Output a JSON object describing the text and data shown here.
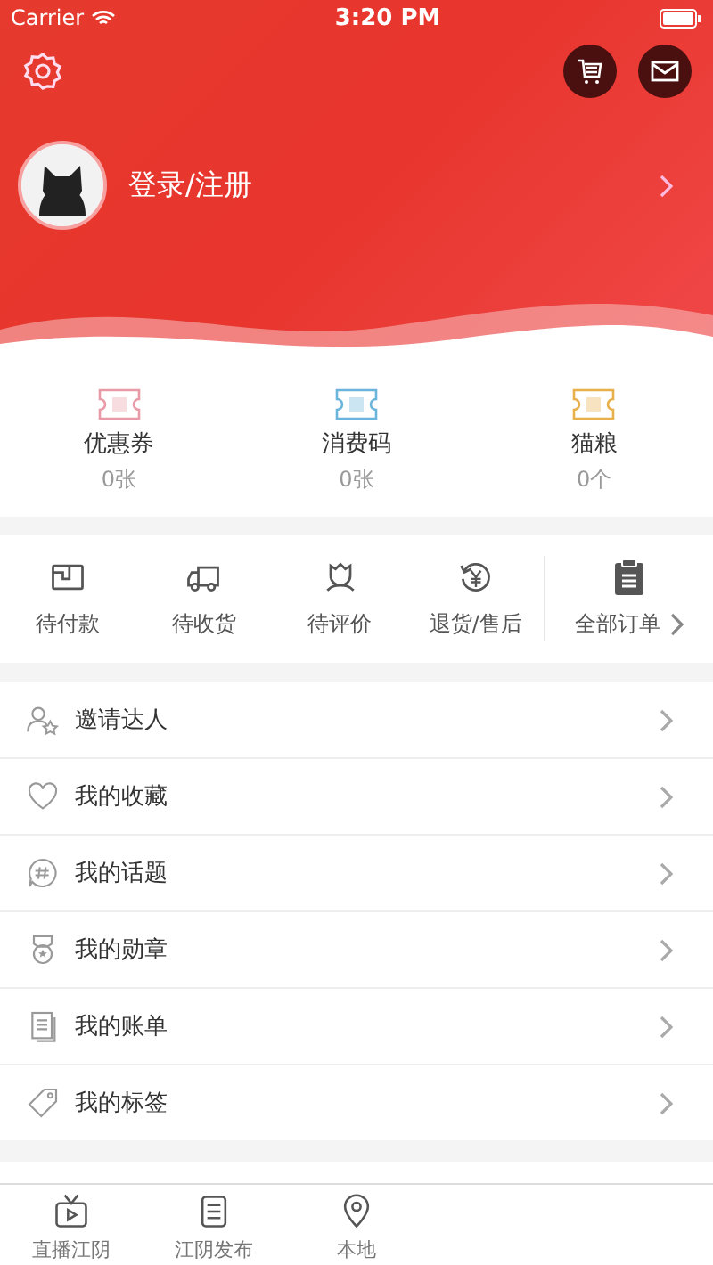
{
  "status_bar": {
    "carrier": "Carrier",
    "time": "3:20 PM"
  },
  "profile": {
    "login_label": "登录/注册"
  },
  "wallet": [
    {
      "kind": "coupon",
      "label": "优惠券",
      "count": "0张"
    },
    {
      "kind": "code",
      "label": "消费码",
      "count": "0张"
    },
    {
      "kind": "food",
      "label": "猫粮",
      "count": "0个"
    }
  ],
  "orders": [
    {
      "kind": "pay",
      "label": "待付款"
    },
    {
      "kind": "ship",
      "label": "待收货"
    },
    {
      "kind": "review",
      "label": "待评价"
    },
    {
      "kind": "refund",
      "label": "退货/售后"
    }
  ],
  "all_orders": {
    "label": "全部订单"
  },
  "menu": [
    {
      "kind": "invite",
      "label": "邀请达人"
    },
    {
      "kind": "heart",
      "label": "我的收藏"
    },
    {
      "kind": "topic",
      "label": "我的话题"
    },
    {
      "kind": "medal",
      "label": "我的勋章"
    },
    {
      "kind": "bill",
      "label": "我的账单"
    },
    {
      "kind": "tag",
      "label": "我的标签"
    }
  ],
  "tab_bar": [
    {
      "kind": "tv",
      "label": "直播江阴",
      "selected": false
    },
    {
      "kind": "list",
      "label": "江阴发布",
      "selected": false
    },
    {
      "kind": "pin",
      "label": "本地",
      "selected": false
    }
  ]
}
